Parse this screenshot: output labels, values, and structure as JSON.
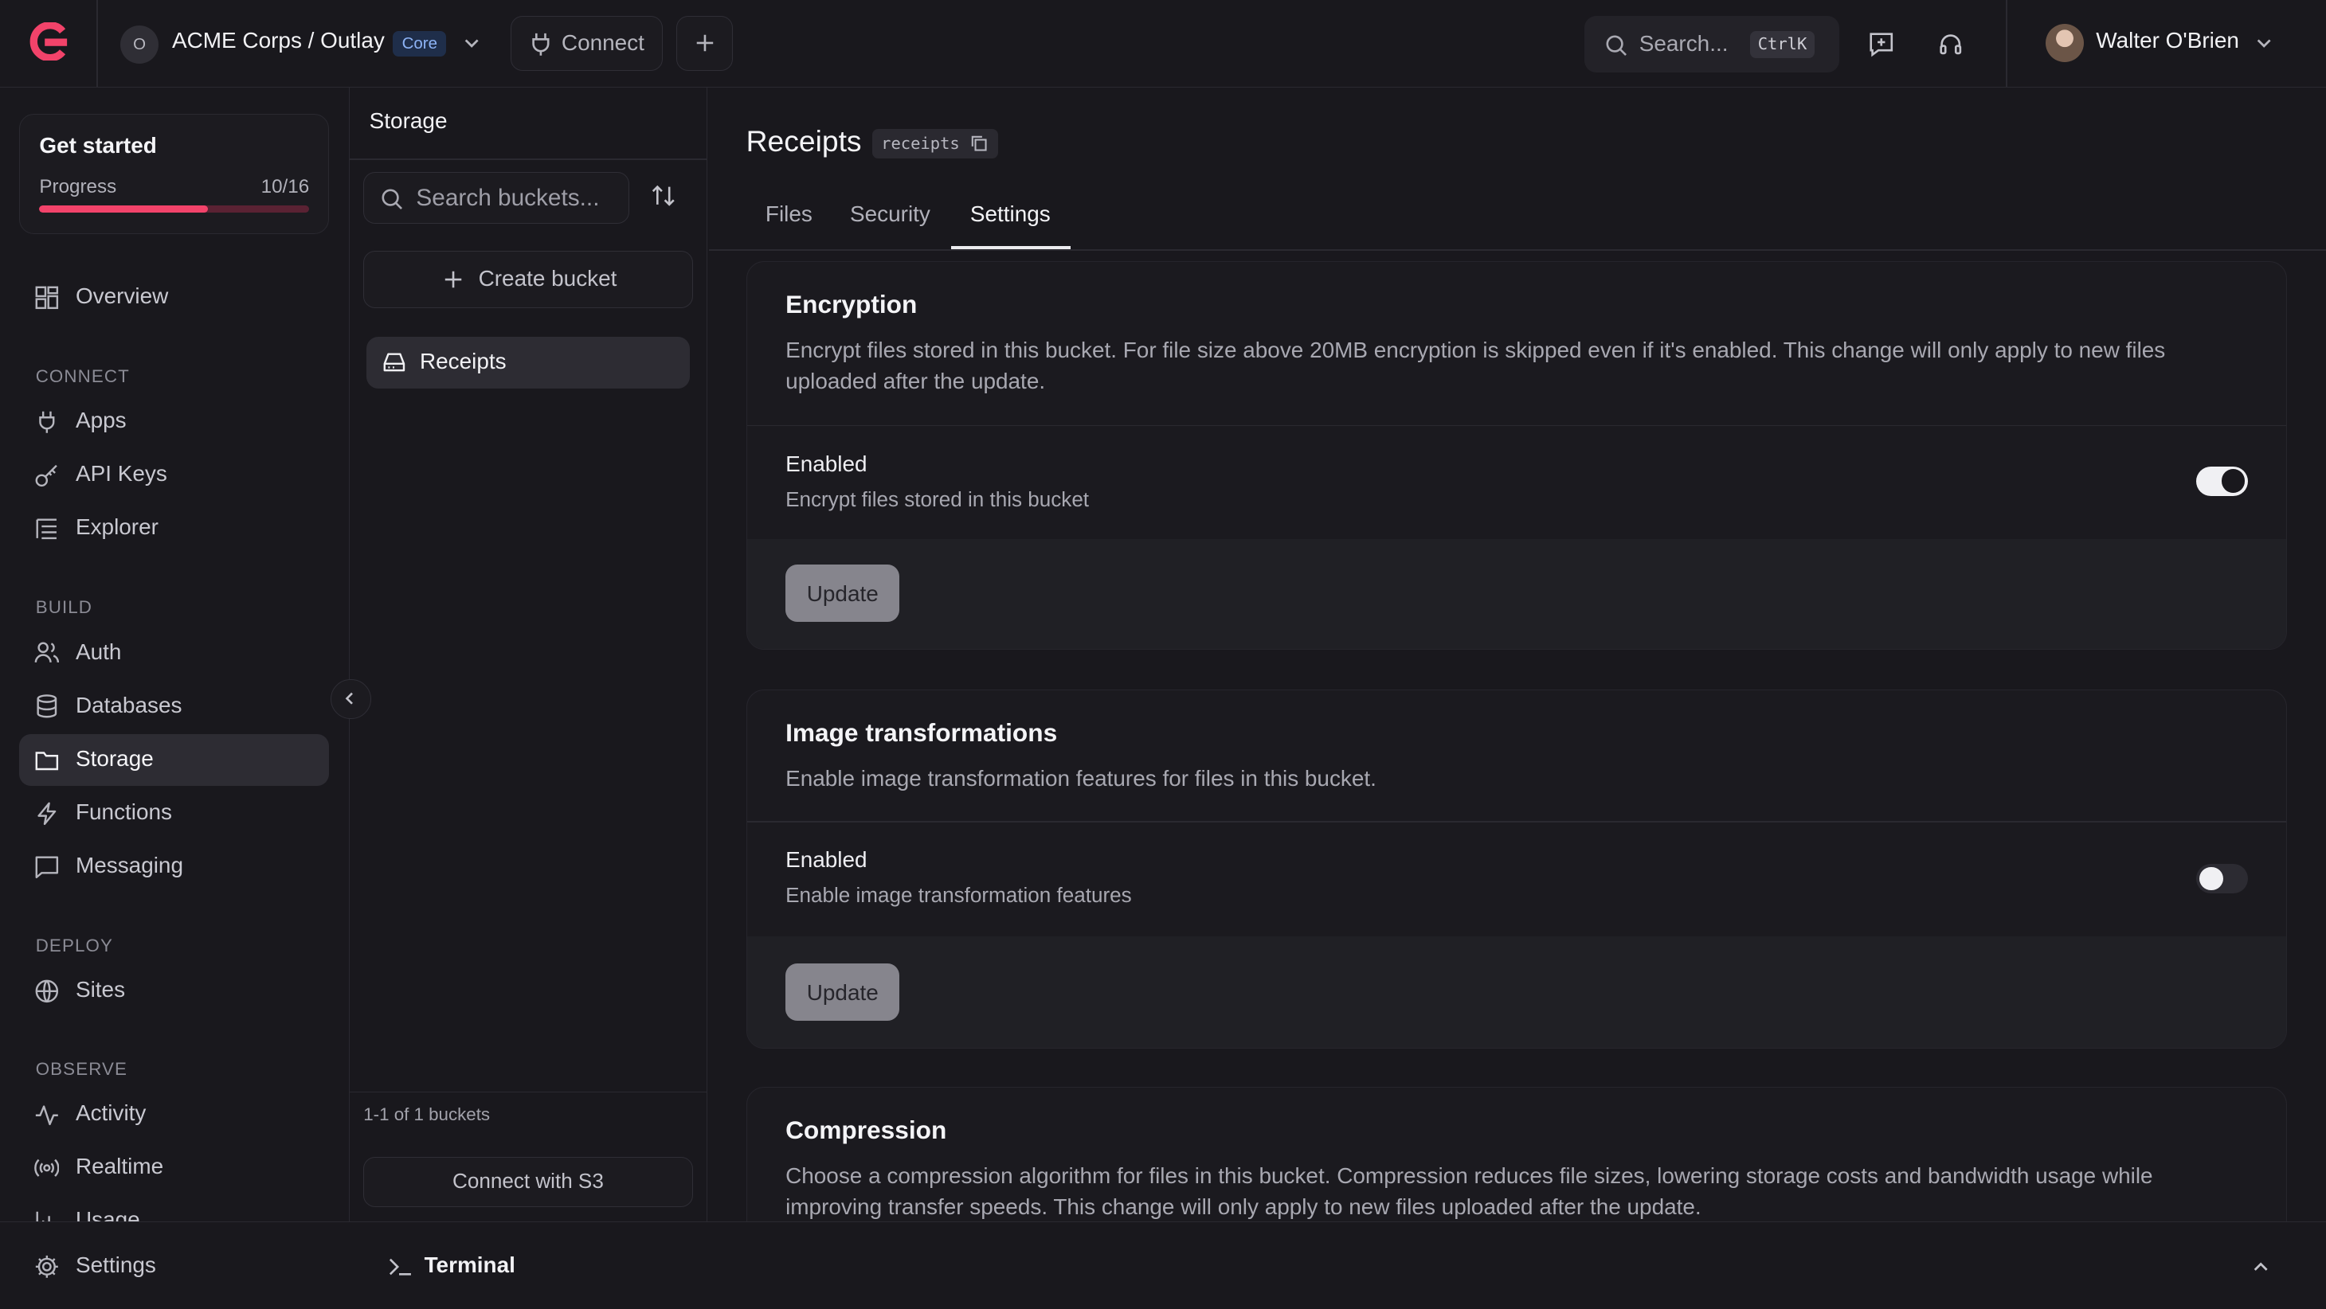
{
  "topbar": {
    "org_initial": "O",
    "org_name": "ACME Corps / Outlay",
    "plan_badge": "Core",
    "connect_label": "Connect",
    "search_placeholder": "Search...",
    "search_shortcut": "CtrlK",
    "user_name": "Walter O'Brien"
  },
  "get_started": {
    "title": "Get started",
    "progress_label": "Progress",
    "progress_text": "10/16",
    "progress_value": 0.625
  },
  "sidebar": {
    "overview": "Overview",
    "sections": {
      "connect": "CONNECT",
      "build": "BUILD",
      "deploy": "DEPLOY",
      "observe": "OBSERVE"
    },
    "items": {
      "apps": "Apps",
      "api_keys": "API Keys",
      "explorer": "Explorer",
      "auth": "Auth",
      "databases": "Databases",
      "storage": "Storage",
      "functions": "Functions",
      "messaging": "Messaging",
      "sites": "Sites",
      "activity": "Activity",
      "realtime": "Realtime",
      "usage": "Usage"
    },
    "settings": "Settings"
  },
  "storage_panel": {
    "title": "Storage",
    "search_placeholder": "Search buckets...",
    "create_label": "Create bucket",
    "buckets": [
      "Receipts"
    ],
    "count_text": "1-1 of 1 buckets",
    "s3_label": "Connect with S3"
  },
  "terminal": {
    "label": "Terminal"
  },
  "main": {
    "title": "Receipts",
    "id": "receipts",
    "tabs": [
      "Files",
      "Security",
      "Settings"
    ],
    "active_tab": "Settings",
    "cards": {
      "encryption": {
        "title": "Encryption",
        "desc": "Encrypt files stored in this bucket. For file size above 20MB encryption is skipped even if it's enabled. This change will only apply to new files uploaded after the update.",
        "row_title": "Enabled",
        "row_desc": "Encrypt files stored in this bucket",
        "enabled": true,
        "button": "Update"
      },
      "image_transformations": {
        "title": "Image transformations",
        "desc": "Enable image transformation features for files in this bucket.",
        "row_title": "Enabled",
        "row_desc": "Enable image transformation features",
        "enabled": false,
        "button": "Update"
      },
      "compression": {
        "title": "Compression",
        "desc": "Choose a compression algorithm for files in this bucket. Compression reduces file sizes, lowering storage costs and bandwidth usage while improving transfer speeds. This change will only apply to new files uploaded after the update."
      }
    }
  },
  "colors": {
    "accent": "#f2436a",
    "background": "#19181d"
  }
}
